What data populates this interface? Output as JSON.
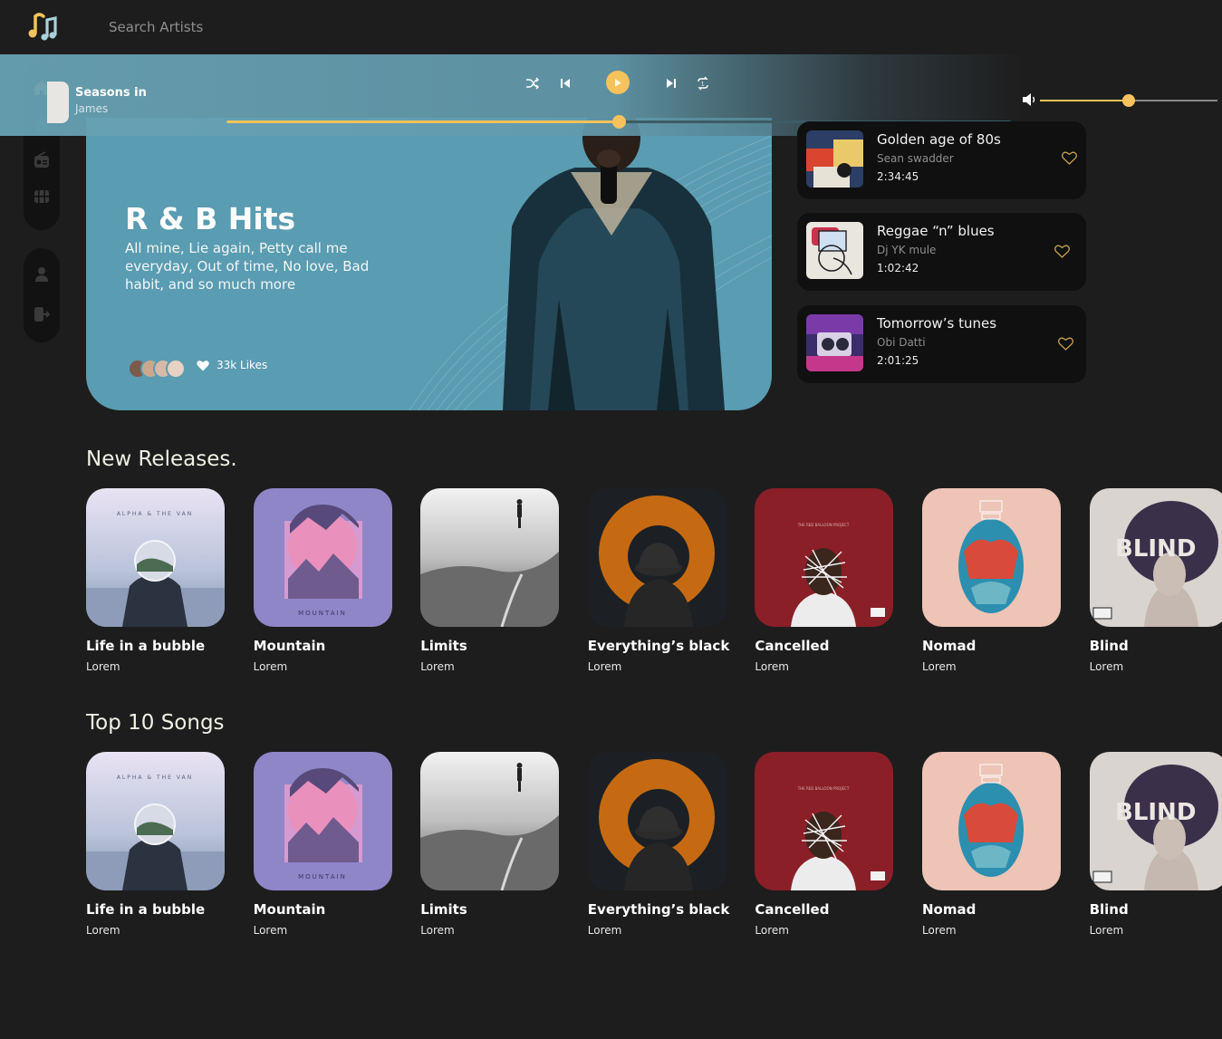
{
  "search": {
    "placeholder": "Search Artists"
  },
  "sidebar": {
    "main": [
      {
        "name": "home-icon",
        "active": true
      },
      {
        "name": "music-bag-icon",
        "active": false
      },
      {
        "name": "radio-icon",
        "active": false
      },
      {
        "name": "video-icon",
        "active": false
      }
    ],
    "secondary": [
      {
        "name": "profile-icon"
      },
      {
        "name": "logout-icon"
      }
    ]
  },
  "player": {
    "title": "Seasons in",
    "artist": "James",
    "progress": 0.5,
    "volume": 0.5
  },
  "hero": {
    "title": "R & B Hits",
    "description": "All mine, Lie again, Petty call me everyday, Out of time, No love, Bad habit, and so much more",
    "likes": "33k Likes"
  },
  "playlists": [
    {
      "title": "Golden age of 80s",
      "artist": "Sean swadder",
      "duration": "2:34:45"
    },
    {
      "title": "Reggae “n” blues",
      "artist": "Dj YK mule",
      "duration": "1:02:42"
    },
    {
      "title": "Tomorrow’s tunes",
      "artist": "Obi Datti",
      "duration": "2:01:25"
    }
  ],
  "new_releases": {
    "heading": "New Releases.",
    "items": [
      {
        "title": "Life in a bubble",
        "subtitle": "Lorem"
      },
      {
        "title": "Mountain",
        "subtitle": "Lorem"
      },
      {
        "title": "Limits",
        "subtitle": "Lorem"
      },
      {
        "title": "Everything’s black",
        "subtitle": "Lorem"
      },
      {
        "title": "Cancelled",
        "subtitle": "Lorem"
      },
      {
        "title": "Nomad",
        "subtitle": "Lorem"
      },
      {
        "title": "Blind",
        "subtitle": "Lorem"
      }
    ]
  },
  "top_songs": {
    "heading": "Top 10 Songs",
    "items": [
      {
        "title": "Life in a bubble",
        "subtitle": "Lorem"
      },
      {
        "title": "Mountain",
        "subtitle": "Lorem"
      },
      {
        "title": "Limits",
        "subtitle": "Lorem"
      },
      {
        "title": "Everything’s black",
        "subtitle": "Lorem"
      },
      {
        "title": "Cancelled",
        "subtitle": "Lorem"
      },
      {
        "title": "Nomad",
        "subtitle": "Lorem"
      },
      {
        "title": "Blind",
        "subtitle": "Lorem"
      }
    ]
  },
  "cover_art_text": {
    "bubble": "ALPHA & THE VAN",
    "mountain": "MOUNTAIN",
    "blind": "BLIND"
  },
  "colors": {
    "accent": "#f5c25c",
    "background": "#1d1d1d",
    "hero": "#5a9cb1",
    "card": "#101010"
  }
}
